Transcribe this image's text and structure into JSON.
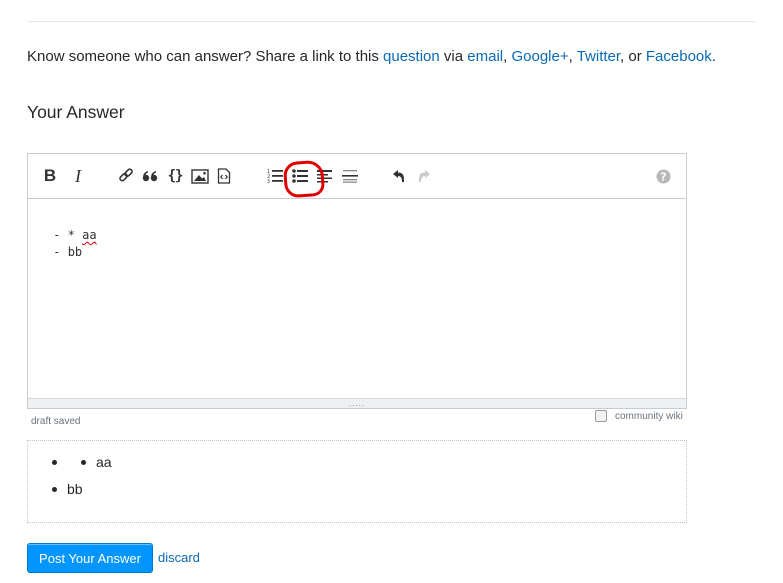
{
  "share": {
    "prefix": "Know someone who can answer? Share a link to this ",
    "question_link": "question",
    "via": " via ",
    "email_link": "email",
    "sep1": ", ",
    "google_link": "Google+",
    "sep2": ", ",
    "twitter_link": "Twitter",
    "or": ", or ",
    "facebook_link": "Facebook",
    "end": "."
  },
  "heading": "Your Answer",
  "toolbar": {
    "buttons": [
      {
        "name": "bold",
        "glyph": "B",
        "title": "Strong"
      },
      {
        "name": "italic",
        "glyph": "I",
        "title": "Emphasis"
      },
      {
        "name": "link",
        "title": "Hyperlink"
      },
      {
        "name": "blockquote",
        "glyph": "“",
        "title": "Blockquote"
      },
      {
        "name": "code",
        "glyph": "{}",
        "title": "Code Sample"
      },
      {
        "name": "image",
        "title": "Image"
      },
      {
        "name": "snippet",
        "title": "Snippet"
      },
      {
        "name": "ordered-list",
        "title": "Numbered List"
      },
      {
        "name": "bulleted-list",
        "title": "Bulleted List",
        "highlighted": true
      },
      {
        "name": "heading",
        "title": "Heading"
      },
      {
        "name": "horizontal-rule",
        "title": "Horizontal Rule"
      },
      {
        "name": "undo",
        "title": "Undo"
      },
      {
        "name": "redo",
        "title": "Redo",
        "disabled": true
      },
      {
        "name": "help",
        "title": "Markdown Editing Help"
      }
    ],
    "highlight_color": "#e00000"
  },
  "editor": {
    "lines": [
      {
        "prefix": " - * ",
        "word": "aa",
        "misspelled": true
      },
      {
        "prefix": " - ",
        "word": "bb",
        "misspelled": false
      }
    ],
    "grip_glyph": "....."
  },
  "status": {
    "draft": "draft saved",
    "community_wiki_label": "community wiki",
    "community_wiki_checked": false
  },
  "preview": {
    "items": [
      {
        "text": "aa",
        "nested": true
      },
      {
        "text": "bb",
        "nested": false
      }
    ]
  },
  "actions": {
    "post_label": "Post Your Answer",
    "discard_label": "discard"
  },
  "colors": {
    "link": "#0a6ab7",
    "primary_button": "#0095ff",
    "annotation": "#e00000"
  }
}
